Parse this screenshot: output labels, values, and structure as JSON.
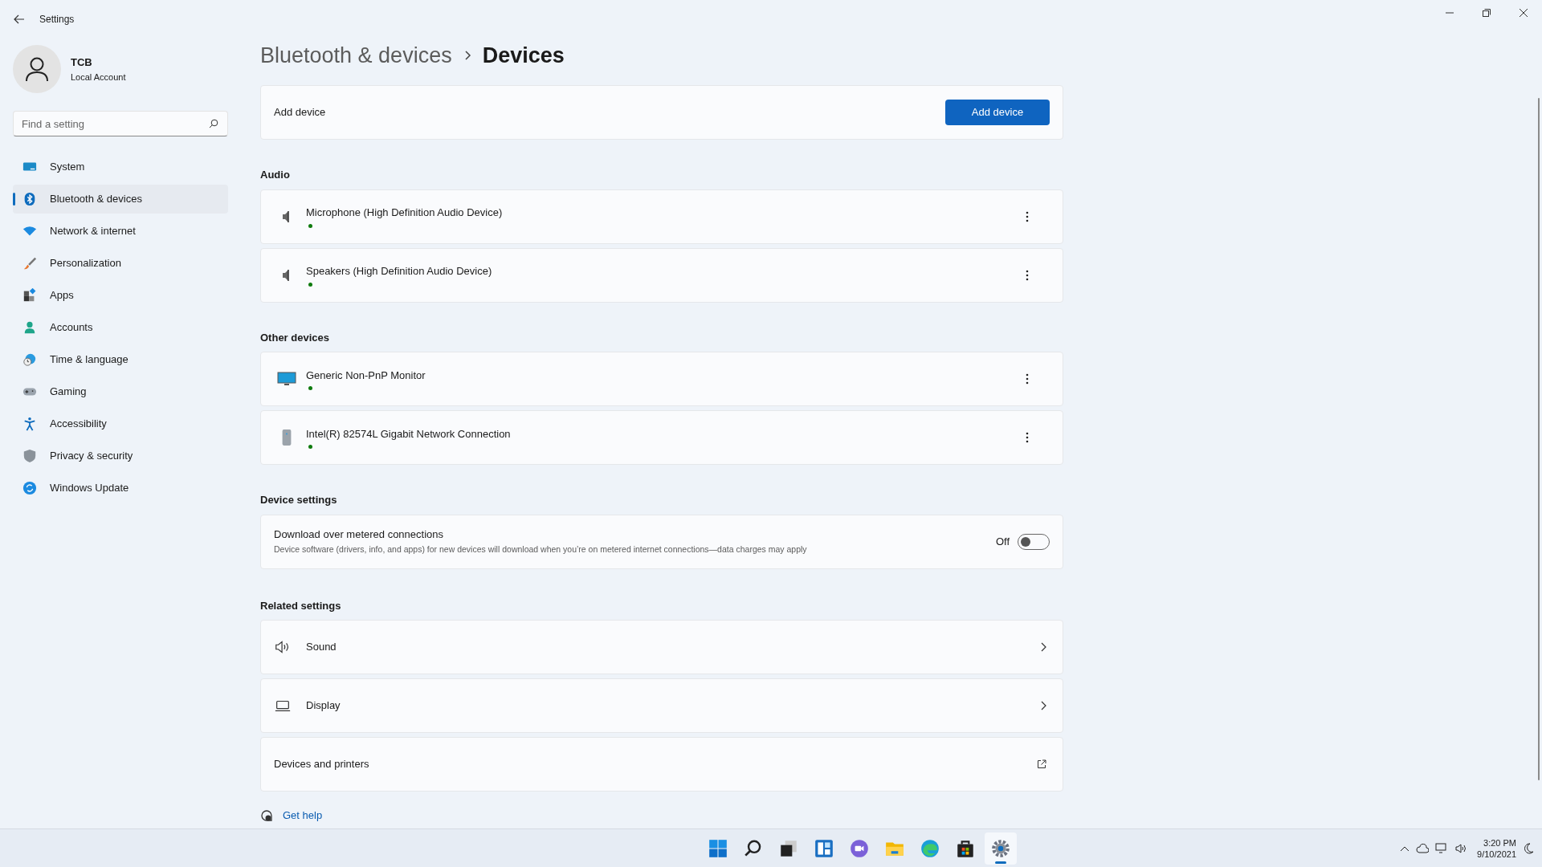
{
  "window": {
    "title": "Settings"
  },
  "user": {
    "name": "TCB",
    "account": "Local Account"
  },
  "search": {
    "placeholder": "Find a setting"
  },
  "nav": [
    {
      "label": "System",
      "selected": false
    },
    {
      "label": "Bluetooth & devices",
      "selected": true
    },
    {
      "label": "Network & internet",
      "selected": false
    },
    {
      "label": "Personalization",
      "selected": false
    },
    {
      "label": "Apps",
      "selected": false
    },
    {
      "label": "Accounts",
      "selected": false
    },
    {
      "label": "Time & language",
      "selected": false
    },
    {
      "label": "Gaming",
      "selected": false
    },
    {
      "label": "Accessibility",
      "selected": false
    },
    {
      "label": "Privacy & security",
      "selected": false
    },
    {
      "label": "Windows Update",
      "selected": false
    }
  ],
  "breadcrumb": {
    "parent": "Bluetooth & devices",
    "current": "Devices"
  },
  "add_device": {
    "label": "Add device",
    "button": "Add device"
  },
  "sections": [
    {
      "heading": "Audio",
      "items": [
        {
          "name": "Microphone (High Definition Audio Device)",
          "kind": "audio",
          "connected": true
        },
        {
          "name": "Speakers (High Definition Audio Device)",
          "kind": "audio",
          "connected": true
        }
      ]
    },
    {
      "heading": "Other devices",
      "items": [
        {
          "name": "Generic Non-PnP Monitor",
          "kind": "monitor",
          "connected": true
        },
        {
          "name": "Intel(R) 82574L Gigabit Network Connection",
          "kind": "tower",
          "connected": true
        }
      ]
    }
  ],
  "device_settings": {
    "heading": "Device settings",
    "title": "Download over metered connections",
    "description": "Device software (drivers, info, and apps) for new devices will download when you’re on metered internet connections—data charges may apply",
    "toggle_label": "Off",
    "on": false
  },
  "related": {
    "heading": "Related settings",
    "items": [
      {
        "label": "Sound",
        "kind": "sound"
      },
      {
        "label": "Display",
        "kind": "display"
      },
      {
        "label": "Devices and printers",
        "kind": "external"
      }
    ]
  },
  "get_help": "Get help",
  "taskbar": {
    "apps": [
      {
        "kind": "start",
        "selected": false
      },
      {
        "kind": "search",
        "selected": false
      },
      {
        "kind": "taskview",
        "selected": false
      },
      {
        "kind": "widgets",
        "selected": false
      },
      {
        "kind": "chat",
        "selected": false
      },
      {
        "kind": "explorer",
        "selected": false
      },
      {
        "kind": "edge",
        "selected": false
      },
      {
        "kind": "store",
        "selected": false
      },
      {
        "kind": "settings",
        "selected": true
      }
    ],
    "time": "3:20 PM",
    "date": "9/10/2021"
  }
}
